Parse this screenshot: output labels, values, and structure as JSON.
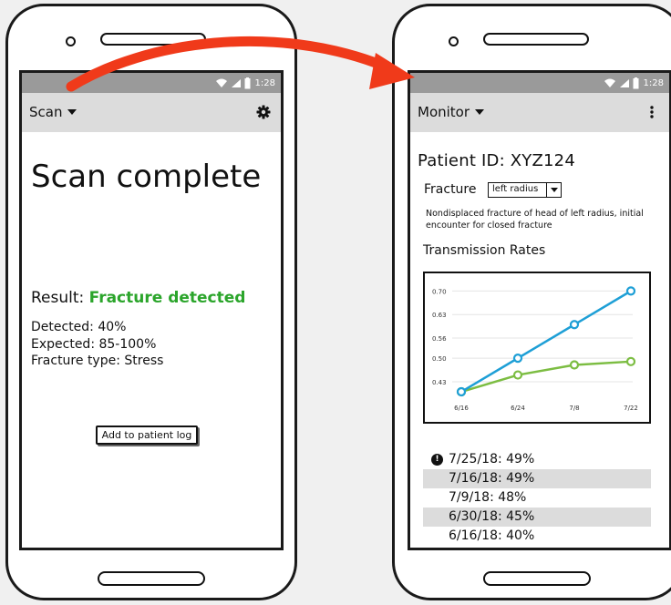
{
  "colors": {
    "accent_green": "#2ba52b",
    "arrow_red": "#f03a1a",
    "series_blue": "#1e9fd6",
    "series_green": "#7cbd42"
  },
  "left_screen": {
    "status_time": "1:28",
    "appbar": {
      "title": "Scan",
      "dropdown_icon": "caret-down-icon",
      "action_icon": "gear-icon"
    },
    "heading": "Scan complete",
    "result": {
      "label": "Result:",
      "value": "Fracture detected"
    },
    "stats": {
      "detected": "Detected: 40%",
      "expected": "Expected: 85-100%",
      "fracture_type": "Fracture type: Stress"
    },
    "add_button_label": "Add to patient log"
  },
  "right_screen": {
    "status_time": "1:28",
    "appbar": {
      "title": "Monitor",
      "dropdown_icon": "caret-down-icon",
      "action_icon": "more-vertical-icon"
    },
    "patient_id": "Patient ID: XYZ124",
    "fracture_label": "Fracture",
    "fracture_select_value": "left radius",
    "fracture_description": "Nondisplaced fracture of head of left radius, initial encounter for closed fracture",
    "transmission_title": "Transmission Rates",
    "history": [
      {
        "text": "7/25/18: 49%",
        "alert": true,
        "shaded": false
      },
      {
        "text": "7/16/18: 49%",
        "alert": false,
        "shaded": true
      },
      {
        "text": "7/9/18: 48%",
        "alert": false,
        "shaded": false
      },
      {
        "text": "6/30/18: 45%",
        "alert": false,
        "shaded": true
      },
      {
        "text": "6/16/18: 40%",
        "alert": false,
        "shaded": false
      }
    ]
  },
  "chart_data": {
    "type": "line",
    "title": "Transmission Rates",
    "categories": [
      "6/16",
      "6/24",
      "7/8",
      "7/22"
    ],
    "yticks": [
      "0.70",
      "0.63",
      "0.56",
      "0.50",
      "0.43"
    ],
    "ylim": [
      0.4,
      0.72
    ],
    "grid": true,
    "series": [
      {
        "values": [
          0.4,
          0.5,
          0.6,
          0.7
        ],
        "color": "#1e9fd6"
      },
      {
        "values": [
          0.4,
          0.45,
          0.48,
          0.49
        ],
        "color": "#7cbd42"
      }
    ]
  }
}
